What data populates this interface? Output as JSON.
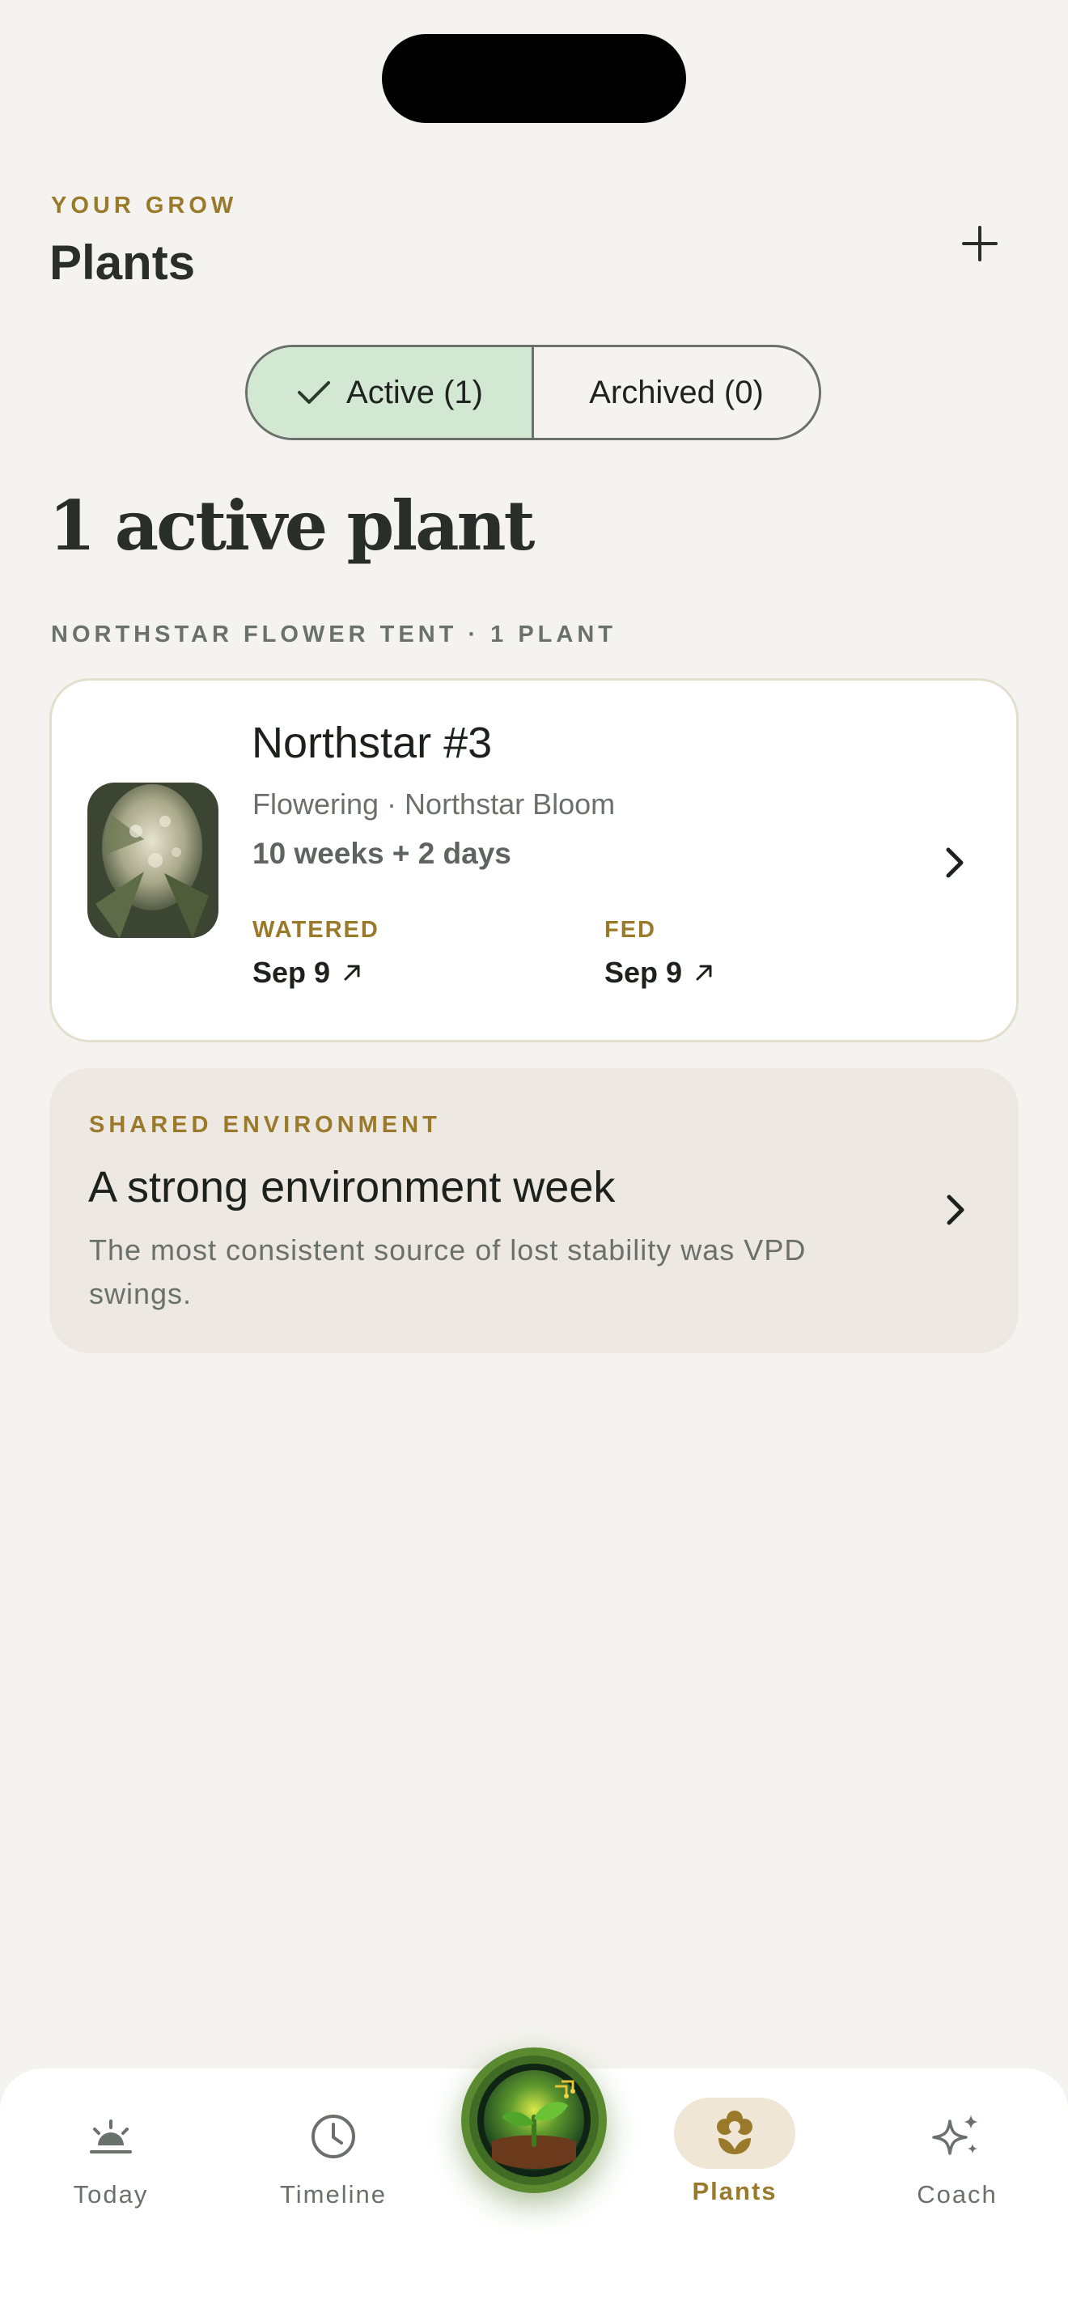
{
  "header": {
    "eyebrow": "YOUR GROW",
    "title": "Plants"
  },
  "filter": {
    "active_label": "Active (1)",
    "archived_label": "Archived (0)"
  },
  "summary": {
    "headline": "1 active plant",
    "group_label": "NORTHSTAR FLOWER TENT · 1 PLANT"
  },
  "plant": {
    "name": "Northstar #3",
    "stage_line": "Flowering · Northstar Bloom",
    "age": "10 weeks + 2 days",
    "watered_label": "WATERED",
    "watered_value": "Sep 9",
    "fed_label": "FED",
    "fed_value": "Sep 9"
  },
  "environment": {
    "eyebrow": "SHARED ENVIRONMENT",
    "title": "A strong environment week",
    "description": "The most consistent source of lost stability was VPD swings."
  },
  "tabbar": {
    "items": [
      {
        "label": "Today",
        "icon": "sunrise-icon"
      },
      {
        "label": "Timeline",
        "icon": "clock-icon"
      },
      {
        "label": "Plants",
        "icon": "flower-icon",
        "active": true
      },
      {
        "label": "Coach",
        "icon": "sparkles-icon"
      }
    ]
  },
  "colors": {
    "background": "#f4f3ef",
    "accent_gold": "#9a7a2a",
    "active_segment": "#d3e8d2",
    "env_card": "#ede8e1"
  }
}
